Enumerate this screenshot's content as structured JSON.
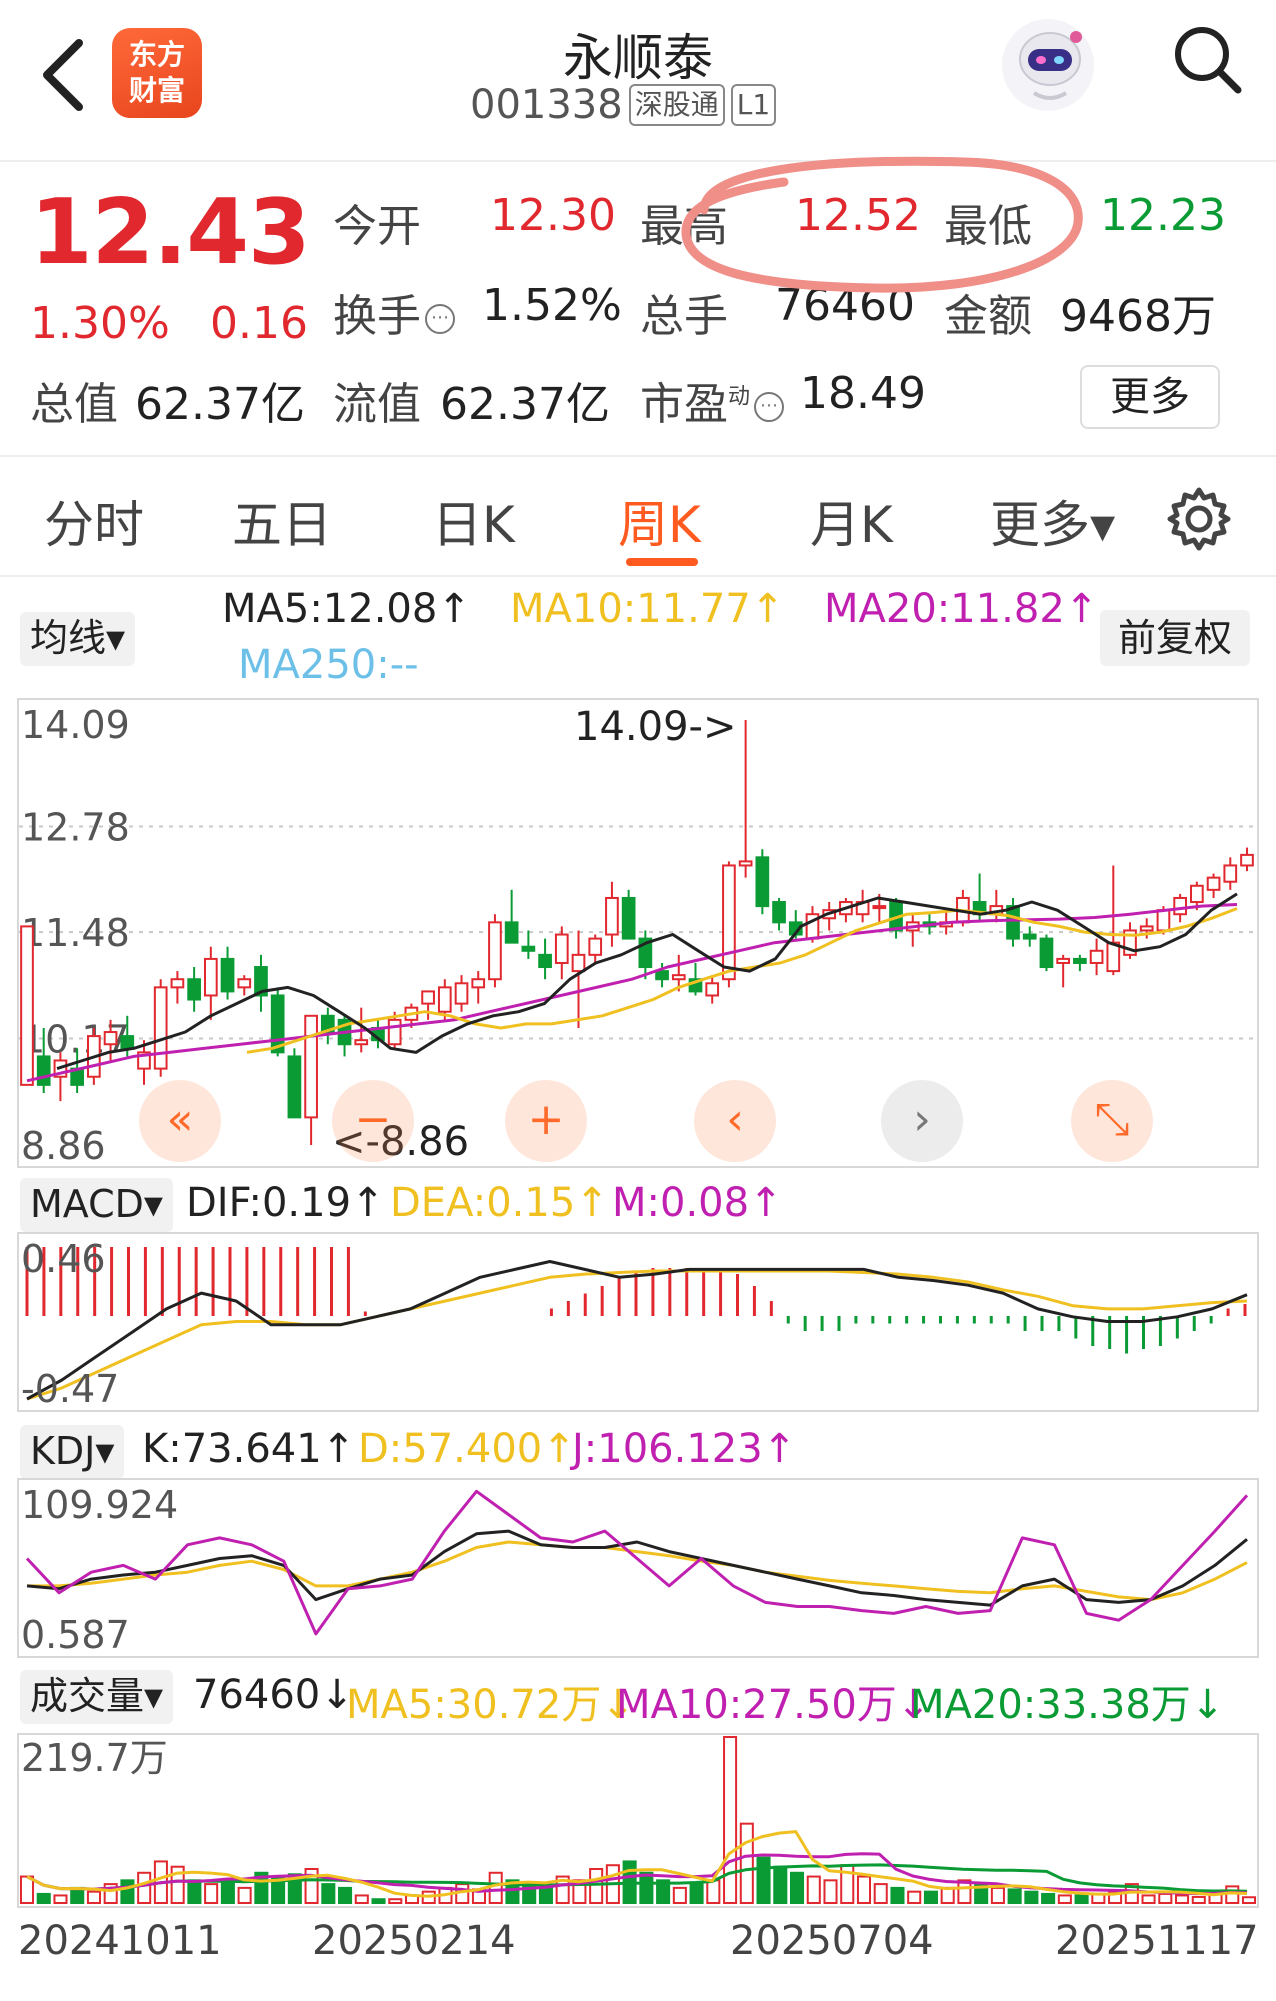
{
  "header": {
    "stock_name": "永顺泰",
    "stock_code": "001338",
    "tag_connect": "深股通",
    "tag_level": "L1",
    "logo_text_line1": "东方",
    "logo_text_line2": "财富"
  },
  "quote": {
    "price": "12.43",
    "change_pct": "1.30%",
    "change_abs": "0.16",
    "open_label": "今开",
    "open_value": "12.30",
    "high_label": "最高",
    "high_value": "12.52",
    "low_label": "最低",
    "low_value": "12.23",
    "turnover_label": "换手",
    "turnover_value": "1.52%",
    "volume_label": "总手",
    "volume_value": "76460",
    "amount_label": "金额",
    "amount_value": "9468万",
    "mktcap_label": "总值",
    "mktcap_value": "62.37亿",
    "float_label": "流值",
    "float_value": "62.37亿",
    "pe_label": "市盈",
    "pe_sup": "动",
    "pe_value": "18.49",
    "more_label": "更多"
  },
  "tabs": [
    "分时",
    "五日",
    "日K",
    "周K",
    "月K",
    "更多▾"
  ],
  "active_tab": "周K",
  "ma_legend": {
    "selector": "均线▾",
    "ma5": "MA5:12.08↑",
    "ma10": "MA10:11.77↑",
    "ma20": "MA20:11.82↑",
    "ma250": "MA250:--",
    "fq": "前复权"
  },
  "kline": {
    "y_labels": [
      "14.09",
      "12.78",
      "11.48",
      "10.17",
      "8.86"
    ],
    "max_annotation": "14.09->",
    "min_annotation": "<-8.86"
  },
  "macd": {
    "selector": "MACD▾",
    "dif": "DIF:0.19↑",
    "dea": "DEA:0.15↑",
    "m": "M:0.08↑",
    "y_top": "0.46",
    "y_bottom": "-0.47"
  },
  "kdj": {
    "selector": "KDJ▾",
    "k": "K:73.641↑",
    "d": "D:57.400↑",
    "j": "J:106.123↑",
    "y_top": "109.924",
    "y_bottom": "0.587"
  },
  "volume": {
    "selector": "成交量▾",
    "value": "76460↓",
    "ma5": "MA5:30.72万↓",
    "ma10": "MA10:27.50万↓",
    "ma20": "MA20:33.38万↓",
    "y_top": "219.7万"
  },
  "x_dates": [
    "20241011",
    "20250214",
    "20250704",
    "20251117"
  ],
  "colors": {
    "up": "#e0282e",
    "down": "#0a9b34",
    "ma5": "#222222",
    "ma10": "#f0c020",
    "ma20": "#c020b0",
    "ma250": "#6cc0e8",
    "accent": "#ff5a1f"
  },
  "chart_data": {
    "type": "candlestick",
    "ohlc": [
      [
        9.6,
        11.55,
        9.6,
        11.55
      ],
      [
        9.95,
        10.3,
        9.5,
        9.6
      ],
      [
        9.7,
        10.0,
        9.4,
        9.9
      ],
      [
        9.8,
        10.05,
        9.5,
        9.6
      ],
      [
        9.7,
        10.3,
        9.6,
        10.2
      ],
      [
        10.1,
        10.4,
        9.9,
        10.25
      ],
      [
        10.2,
        10.45,
        9.95,
        10.05
      ],
      [
        9.8,
        10.15,
        9.6,
        10.0
      ],
      [
        9.8,
        10.9,
        9.7,
        10.8
      ],
      [
        10.8,
        11.0,
        10.6,
        10.9
      ],
      [
        10.9,
        11.05,
        10.5,
        10.65
      ],
      [
        10.7,
        11.3,
        10.4,
        11.15
      ],
      [
        11.15,
        11.3,
        10.65,
        10.75
      ],
      [
        10.8,
        10.95,
        10.7,
        10.9
      ],
      [
        11.05,
        11.2,
        10.5,
        10.7
      ],
      [
        10.7,
        10.8,
        9.95,
        10.0
      ],
      [
        9.95,
        10.05,
        9.2,
        9.2
      ],
      [
        9.2,
        10.45,
        8.86,
        10.45
      ],
      [
        10.45,
        10.55,
        10.1,
        10.25
      ],
      [
        10.4,
        10.45,
        9.95,
        10.1
      ],
      [
        10.1,
        10.55,
        10.0,
        10.15
      ],
      [
        10.3,
        10.4,
        10.05,
        10.15
      ],
      [
        10.1,
        10.5,
        10.05,
        10.4
      ],
      [
        10.4,
        10.6,
        10.3,
        10.55
      ],
      [
        10.6,
        10.75,
        10.4,
        10.75
      ],
      [
        10.5,
        10.9,
        10.4,
        10.8
      ],
      [
        10.6,
        10.95,
        10.5,
        10.85
      ],
      [
        10.8,
        11.0,
        10.6,
        10.9
      ],
      [
        10.9,
        11.7,
        10.8,
        11.6
      ],
      [
        11.6,
        12.0,
        11.35,
        11.35
      ],
      [
        11.3,
        11.5,
        11.15,
        11.25
      ],
      [
        11.2,
        11.4,
        10.9,
        11.05
      ],
      [
        11.1,
        11.55,
        10.9,
        11.45
      ],
      [
        11.0,
        11.5,
        10.3,
        11.2
      ],
      [
        11.2,
        11.45,
        11.1,
        11.4
      ],
      [
        11.45,
        12.1,
        11.3,
        11.9
      ],
      [
        11.9,
        12.0,
        11.4,
        11.4
      ],
      [
        11.4,
        11.5,
        10.9,
        11.05
      ],
      [
        11.0,
        11.1,
        10.8,
        10.9
      ],
      [
        10.9,
        11.2,
        10.75,
        10.95
      ],
      [
        10.9,
        11.1,
        10.7,
        10.75
      ],
      [
        10.7,
        10.95,
        10.6,
        10.85
      ],
      [
        10.9,
        12.35,
        10.8,
        12.3
      ],
      [
        12.3,
        14.09,
        12.15,
        12.35
      ],
      [
        12.4,
        12.5,
        11.7,
        11.8
      ],
      [
        11.85,
        11.9,
        11.5,
        11.6
      ],
      [
        11.6,
        11.75,
        11.4,
        11.45
      ],
      [
        11.4,
        11.8,
        11.35,
        11.7
      ],
      [
        11.65,
        11.85,
        11.5,
        11.75
      ],
      [
        11.7,
        11.9,
        11.6,
        11.85
      ],
      [
        11.7,
        12.0,
        11.6,
        11.85
      ],
      [
        11.8,
        11.95,
        11.6,
        11.8
      ],
      [
        11.85,
        11.9,
        11.4,
        11.5
      ],
      [
        11.5,
        11.7,
        11.3,
        11.6
      ],
      [
        11.6,
        11.7,
        11.45,
        11.55
      ],
      [
        11.55,
        11.75,
        11.45,
        11.6
      ],
      [
        11.6,
        12.0,
        11.55,
        11.9
      ],
      [
        11.85,
        12.2,
        11.6,
        11.7
      ],
      [
        11.7,
        12.0,
        11.6,
        11.8
      ],
      [
        11.8,
        11.9,
        11.3,
        11.4
      ],
      [
        11.45,
        11.55,
        11.3,
        11.4
      ],
      [
        11.4,
        11.45,
        11.0,
        11.05
      ],
      [
        11.1,
        11.2,
        10.8,
        11.15
      ],
      [
        11.15,
        11.2,
        11.0,
        11.1
      ],
      [
        11.1,
        11.4,
        10.95,
        11.25
      ],
      [
        11.0,
        12.3,
        10.95,
        11.35
      ],
      [
        11.2,
        11.6,
        11.15,
        11.5
      ],
      [
        11.5,
        11.65,
        11.4,
        11.55
      ],
      [
        11.5,
        11.8,
        11.45,
        11.75
      ],
      [
        11.7,
        11.95,
        11.6,
        11.9
      ],
      [
        11.85,
        12.1,
        11.75,
        12.05
      ],
      [
        12.0,
        12.2,
        11.9,
        12.15
      ],
      [
        12.1,
        12.4,
        12.0,
        12.3
      ],
      [
        12.3,
        12.52,
        12.23,
        12.43
      ]
    ],
    "ma5": [
      9.8,
      9.9,
      10.0,
      10.05,
      10.15,
      10.25,
      10.45,
      10.6,
      10.75,
      10.8,
      10.7,
      10.5,
      10.3,
      10.05,
      10.0,
      10.2,
      10.35,
      10.45,
      10.5,
      10.6,
      10.9,
      11.1,
      11.2,
      11.35,
      11.45,
      11.25,
      11.05,
      11.0,
      11.15,
      11.55,
      11.7,
      11.8,
      11.9,
      11.85,
      11.8,
      11.75,
      11.7,
      11.75,
      11.85,
      11.75,
      11.55,
      11.35,
      11.25,
      11.3,
      11.45,
      11.75,
      11.95
    ],
    "ma10": [
      10.0,
      10.05,
      10.15,
      10.25,
      10.35,
      10.4,
      10.45,
      10.5,
      10.45,
      10.35,
      10.3,
      10.35,
      10.35,
      10.4,
      10.45,
      10.55,
      10.65,
      10.8,
      10.9,
      11.0,
      11.05,
      11.1,
      11.2,
      11.35,
      11.5,
      11.6,
      11.7,
      11.72,
      11.75,
      11.72,
      11.68,
      11.6,
      11.55,
      11.48,
      11.45,
      11.44,
      11.48,
      11.55,
      11.65,
      11.77
    ],
    "ma20": [
      9.65,
      9.75,
      9.85,
      9.95,
      10.0,
      10.05,
      10.1,
      10.15,
      10.2,
      10.25,
      10.3,
      10.35,
      10.4,
      10.5,
      10.6,
      10.7,
      10.8,
      10.9,
      11.05,
      11.15,
      11.25,
      11.35,
      11.4,
      11.45,
      11.5,
      11.55,
      11.6,
      11.62,
      11.63,
      11.64,
      11.66,
      11.7,
      11.75,
      11.8,
      11.82
    ],
    "macd_dif": [
      -0.47,
      -0.35,
      -0.2,
      -0.05,
      0.1,
      0.2,
      0.15,
      0.0,
      0.0,
      0.0,
      0.05,
      0.1,
      0.2,
      0.3,
      0.35,
      0.4,
      0.35,
      0.3,
      0.32,
      0.35,
      0.35,
      0.35,
      0.35,
      0.35,
      0.35,
      0.3,
      0.28,
      0.25,
      0.2,
      0.1,
      0.05,
      0.02,
      0.02,
      0.05,
      0.1,
      0.19
    ],
    "macd_dea": [
      -0.47,
      -0.4,
      -0.3,
      -0.2,
      -0.1,
      0.0,
      0.02,
      0.02,
      0.0,
      0.0,
      0.05,
      0.1,
      0.15,
      0.2,
      0.25,
      0.3,
      0.32,
      0.33,
      0.34,
      0.34,
      0.34,
      0.34,
      0.34,
      0.34,
      0.33,
      0.32,
      0.3,
      0.27,
      0.22,
      0.18,
      0.12,
      0.1,
      0.1,
      0.12,
      0.14,
      0.15
    ],
    "macd_hist": [
      0.46,
      0.46,
      0.46,
      0.46,
      0.46,
      0.46,
      0.46,
      0.46,
      0.46,
      0.46,
      0.46,
      0.46,
      0.46,
      0.46,
      0.46,
      0.46,
      0.46,
      0.46,
      0.46,
      0.46,
      0.03,
      0.0,
      0.0,
      0.0,
      0.0,
      0.0,
      0.0,
      0.0,
      0.0,
      0.0,
      0.0,
      0.05,
      0.1,
      0.15,
      0.2,
      0.26,
      0.3,
      0.32,
      0.32,
      0.32,
      0.32,
      0.3,
      0.28,
      0.2,
      0.1,
      -0.05,
      -0.1,
      -0.1,
      -0.1,
      -0.05,
      -0.05,
      -0.05,
      -0.05,
      -0.05,
      -0.05,
      -0.05,
      -0.05,
      -0.05,
      -0.05,
      -0.1,
      -0.1,
      -0.1,
      -0.15,
      -0.2,
      -0.22,
      -0.25,
      -0.22,
      -0.2,
      -0.15,
      -0.1,
      -0.05,
      0.05,
      0.08
    ],
    "kdj_k": [
      40,
      38,
      45,
      48,
      50,
      55,
      60,
      62,
      55,
      30,
      38,
      45,
      48,
      65,
      78,
      80,
      70,
      68,
      68,
      72,
      65,
      60,
      55,
      50,
      45,
      40,
      35,
      33,
      30,
      28,
      26,
      40,
      45,
      30,
      28,
      30,
      40,
      55,
      74
    ],
    "kdj_d": [
      40,
      40,
      42,
      45,
      48,
      50,
      55,
      58,
      52,
      40,
      40,
      45,
      50,
      58,
      68,
      72,
      70,
      68,
      68,
      65,
      62,
      58,
      55,
      50,
      47,
      44,
      42,
      40,
      38,
      36,
      35,
      38,
      40,
      36,
      32,
      30,
      35,
      45,
      57
    ],
    "kdj_j": [
      60,
      35,
      50,
      55,
      45,
      70,
      75,
      70,
      58,
      5,
      38,
      40,
      45,
      80,
      109,
      92,
      75,
      72,
      80,
      60,
      40,
      60,
      40,
      28,
      25,
      25,
      22,
      20,
      25,
      20,
      22,
      75,
      70,
      20,
      15,
      30,
      55,
      80,
      106
    ],
    "volume_wan": [
      35,
      12,
      10,
      20,
      15,
      25,
      30,
      40,
      55,
      48,
      30,
      25,
      30,
      20,
      40,
      35,
      38,
      45,
      25,
      20,
      10,
      5,
      5,
      10,
      15,
      20,
      25,
      18,
      40,
      30,
      25,
      20,
      35,
      30,
      45,
      50,
      55,
      40,
      30,
      20,
      25,
      30,
      219.7,
      105,
      60,
      48,
      40,
      35,
      30,
      50,
      35,
      25,
      20,
      15,
      15,
      20,
      30,
      25,
      20,
      18,
      15,
      12,
      10,
      10,
      12,
      15,
      25,
      10,
      12,
      10,
      8,
      15,
      22,
      7.6
    ],
    "volume_ma": {
      "ma5": 30.72,
      "ma10": 27.5,
      "ma20": 33.38
    }
  }
}
